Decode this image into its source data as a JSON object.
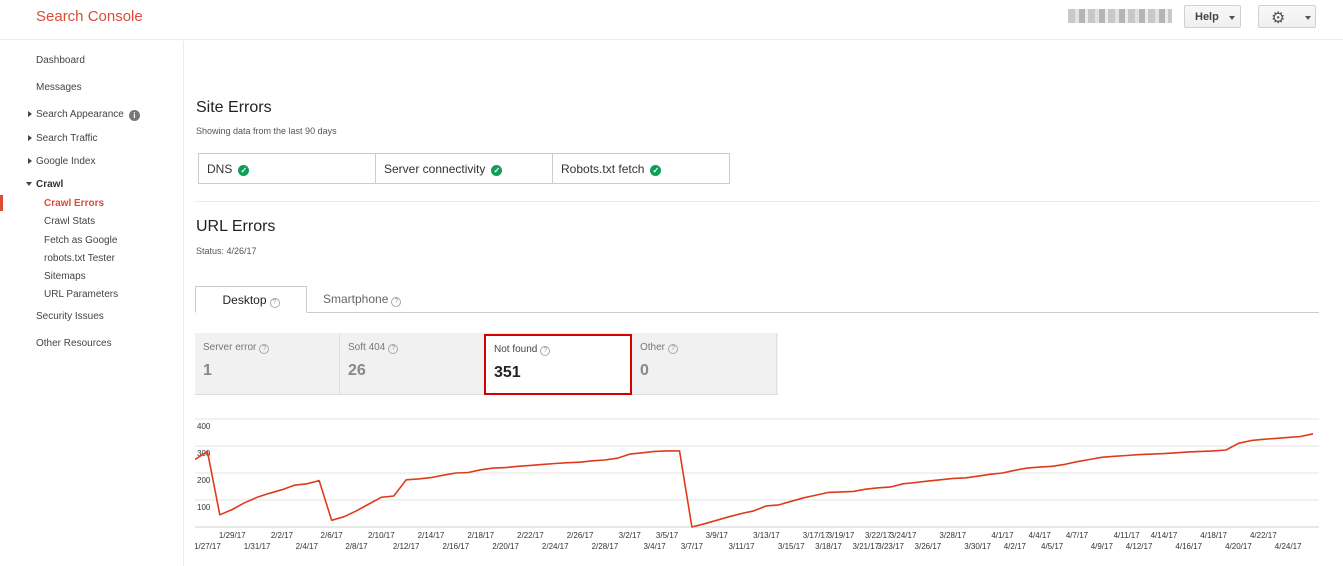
{
  "header": {
    "app_title": "Search Console",
    "help_label": "Help",
    "settings_icon": "gear-icon"
  },
  "sidebar": {
    "items": [
      {
        "label": "Dashboard"
      },
      {
        "label": "Messages"
      },
      {
        "label": "Search Appearance"
      },
      {
        "label": "Search Traffic"
      },
      {
        "label": "Google Index"
      },
      {
        "label": "Crawl"
      },
      {
        "label": "Crawl Errors"
      },
      {
        "label": "Crawl Stats"
      },
      {
        "label": "Fetch as Google"
      },
      {
        "label": "robots.txt Tester"
      },
      {
        "label": "Sitemaps"
      },
      {
        "label": "URL Parameters"
      },
      {
        "label": "Security Issues"
      },
      {
        "label": "Other Resources"
      }
    ],
    "active_item": "Crawl Errors"
  },
  "site_errors": {
    "title": "Site Errors",
    "subtitle": "Showing data from the last 90 days",
    "checks": [
      {
        "label": "DNS",
        "status": "ok"
      },
      {
        "label": "Server connectivity",
        "status": "ok"
      },
      {
        "label": "Robots.txt fetch",
        "status": "ok"
      }
    ]
  },
  "url_errors": {
    "title": "URL Errors",
    "status": "Status: 4/26/17",
    "tabs": [
      {
        "label": "Desktop",
        "selected": true
      },
      {
        "label": "Smartphone",
        "selected": false
      }
    ],
    "metrics": [
      {
        "label": "Server error",
        "value": "1"
      },
      {
        "label": "Soft 404",
        "value": "26"
      },
      {
        "label": "Not found",
        "value": "351",
        "selected": true
      },
      {
        "label": "Other",
        "value": "0"
      }
    ]
  },
  "colors": {
    "brand": "#dd4b39",
    "line": "#dd3b1b",
    "ok": "#0f9d58",
    "selected_border": "#d50000"
  },
  "chart_data": {
    "type": "line",
    "ylim": [
      0,
      400
    ],
    "yticks": [
      100,
      200,
      300,
      400
    ],
    "grid": true,
    "xlim": [
      "1/26/17",
      "4/26/17"
    ],
    "xtick_labels_top": [
      "1/29/17",
      "2/2/17",
      "2/6/17",
      "2/10/17",
      "2/14/17",
      "2/18/17",
      "2/22/17",
      "2/26/17",
      "3/2/17",
      "3/5/17",
      "3/9/17",
      "3/13/17",
      "3/17/17",
      "3/19/17",
      "3/22/17",
      "3/24/17",
      "3/28/17",
      "4/1/17",
      "4/4/17",
      "4/7/17",
      "4/11/17",
      "4/14/17",
      "4/18/17",
      "4/22/17"
    ],
    "xtick_labels_bottom": [
      "1/27/17",
      "1/31/17",
      "2/4/17",
      "2/8/17",
      "2/12/17",
      "2/16/17",
      "2/20/17",
      "2/24/17",
      "2/28/17",
      "3/4/17",
      "3/7/17",
      "3/11/17",
      "3/15/17",
      "3/18/17",
      "3/21/17",
      "3/23/17",
      "3/26/17",
      "3/30/17",
      "4/2/17",
      "4/5/17",
      "4/9/17",
      "4/12/17",
      "4/16/17",
      "4/20/17",
      "4/24/17"
    ],
    "series": [
      {
        "x": [
          "1/26/17",
          "1/27/17",
          "1/28/17",
          "1/29/17",
          "1/30/17",
          "1/31/17",
          "2/1/17",
          "2/2/17",
          "2/3/17",
          "2/4/17",
          "2/5/17",
          "2/6/17",
          "2/7/17",
          "2/8/17",
          "2/9/17",
          "2/10/17",
          "2/11/17",
          "2/12/17",
          "2/13/17",
          "2/14/17",
          "2/15/17",
          "2/16/17",
          "2/17/17",
          "2/18/17",
          "2/19/17",
          "2/20/17",
          "2/21/17",
          "2/22/17",
          "2/23/17",
          "2/24/17",
          "2/25/17",
          "2/26/17",
          "2/27/17",
          "2/28/17",
          "3/1/17",
          "3/2/17",
          "3/3/17",
          "3/4/17",
          "3/5/17",
          "3/6/17",
          "3/7/17",
          "3/8/17",
          "3/9/17",
          "3/10/17",
          "3/11/17",
          "3/12/17",
          "3/13/17",
          "3/14/17",
          "3/15/17",
          "3/16/17",
          "3/17/17",
          "3/18/17",
          "3/19/17",
          "3/20/17",
          "3/21/17",
          "3/22/17",
          "3/23/17",
          "3/24/17",
          "3/25/17",
          "3/26/17",
          "3/27/17",
          "3/28/17",
          "3/29/17",
          "3/30/17",
          "3/31/17",
          "4/1/17",
          "4/2/17",
          "4/3/17",
          "4/4/17",
          "4/5/17",
          "4/6/17",
          "4/7/17",
          "4/8/17",
          "4/9/17",
          "4/10/17",
          "4/11/17",
          "4/12/17",
          "4/13/17",
          "4/14/17",
          "4/15/17",
          "4/16/17",
          "4/17/17",
          "4/18/17",
          "4/19/17",
          "4/20/17",
          "4/21/17",
          "4/22/17",
          "4/23/17",
          "4/24/17",
          "4/25/17",
          "4/26/17"
        ],
        "values": [
          250,
          280,
          45,
          65,
          90,
          110,
          125,
          138,
          155,
          160,
          172,
          25,
          38,
          60,
          85,
          110,
          115,
          175,
          178,
          183,
          192,
          200,
          202,
          212,
          218,
          220,
          225,
          228,
          232,
          235,
          238,
          240,
          245,
          248,
          255,
          270,
          275,
          280,
          282,
          282,
          0,
          12,
          25,
          38,
          50,
          60,
          78,
          82,
          95,
          108,
          118,
          128,
          130,
          132,
          140,
          145,
          148,
          160,
          165,
          170,
          175,
          180,
          182,
          188,
          195,
          200,
          210,
          218,
          222,
          225,
          232,
          242,
          250,
          258,
          262,
          265,
          268,
          270,
          272,
          275,
          278,
          280,
          282,
          285,
          310,
          320,
          325,
          328,
          332,
          335,
          345
        ]
      }
    ]
  }
}
